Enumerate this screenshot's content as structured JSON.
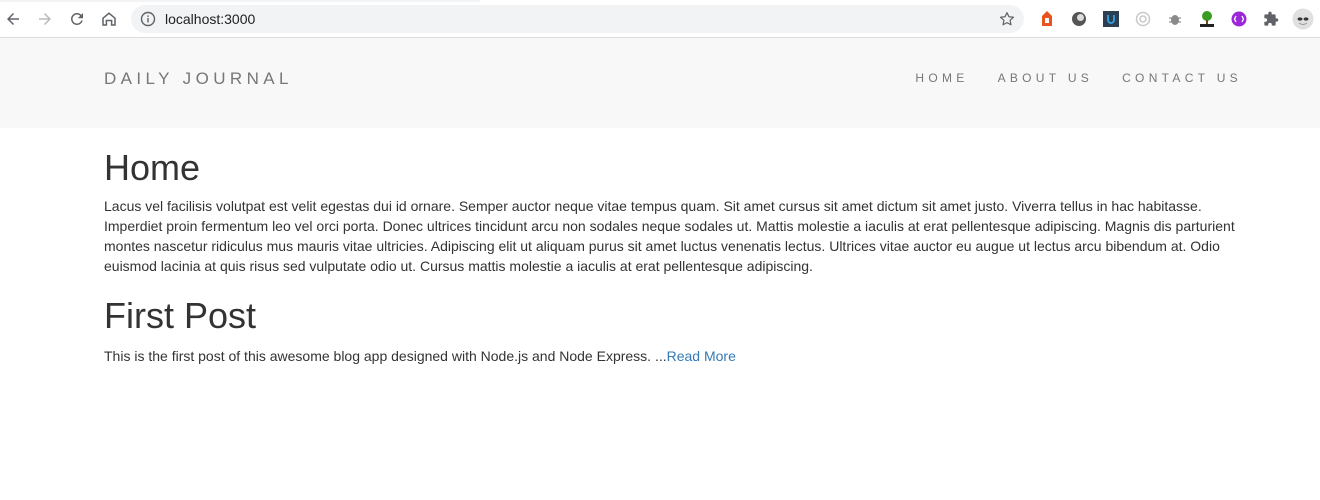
{
  "browser": {
    "url": "localhost:3000",
    "icons": {
      "back": "arrow-left-icon",
      "forward": "arrow-right-icon",
      "reload": "reload-icon",
      "home": "home-icon",
      "info": "info-icon",
      "bookmark": "star-icon",
      "extensions": [
        "extension-red-icon",
        "extension-circle-icon",
        "extension-u-icon",
        "extension-target-icon",
        "extension-bug-icon",
        "extension-tree-icon",
        "extension-purple-icon",
        "puzzle-icon",
        "profile-avatar-icon"
      ]
    }
  },
  "site": {
    "brand": "DAILY JOURNAL",
    "nav": [
      "HOME",
      "ABOUT US",
      "CONTACT US"
    ]
  },
  "main": {
    "home_title": "Home",
    "home_text": "Lacus vel facilisis volutpat est velit egestas dui id ornare. Semper auctor neque vitae tempus quam. Sit amet cursus sit amet dictum sit amet justo. Viverra tellus in hac habitasse. Imperdiet proin fermentum leo vel orci porta. Donec ultrices tincidunt arcu non sodales neque sodales ut. Mattis molestie a iaculis at erat pellentesque adipiscing. Magnis dis parturient montes nascetur ridiculus mus mauris vitae ultricies. Adipiscing elit ut aliquam purus sit amet luctus venenatis lectus. Ultrices vitae auctor eu augue ut lectus arcu bibendum at. Odio euismod lacinia at quis risus sed vulputate odio ut. Cursus mattis molestie a iaculis at erat pellentesque adipiscing.",
    "posts": [
      {
        "title": "First Post",
        "excerpt": "This is the first post of this awesome blog app designed with Node.js and Node Express. ...",
        "read_more": "Read More"
      }
    ]
  },
  "colors": {
    "header_bg": "#f8f8f8",
    "nav_text": "#777777",
    "body_text": "#333333",
    "link": "#337ab7"
  }
}
